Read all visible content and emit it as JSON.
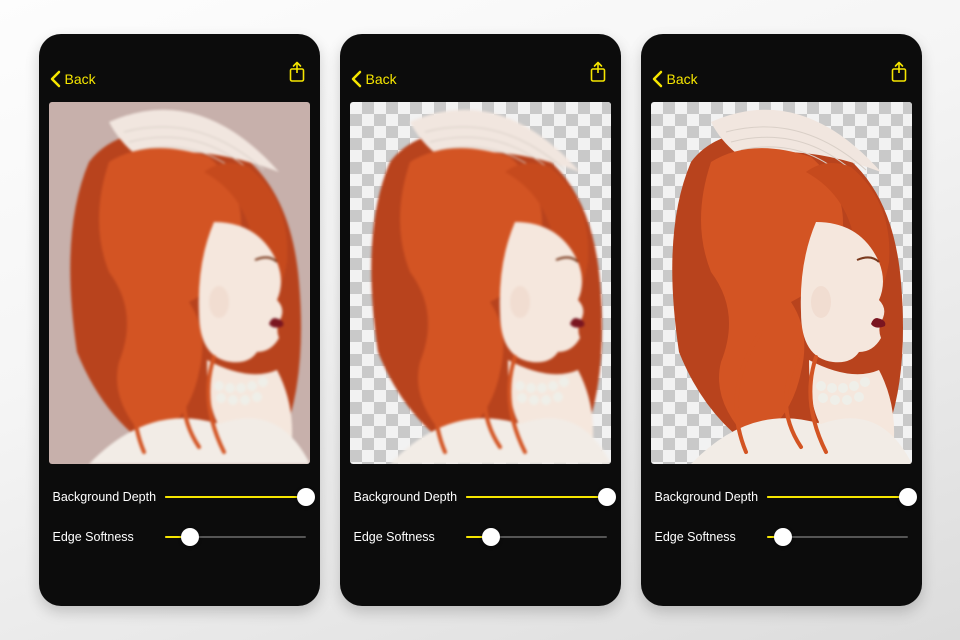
{
  "accentColor": "#f6e600",
  "screens": [
    {
      "back_label": "Back",
      "background": "solid",
      "sliders": {
        "bg_depth": {
          "label": "Background Depth",
          "value": 100
        },
        "edge_soft": {
          "label": "Edge Softness",
          "value": 18
        }
      }
    },
    {
      "back_label": "Back",
      "background": "transparent",
      "sliders": {
        "bg_depth": {
          "label": "Background Depth",
          "value": 100
        },
        "edge_soft": {
          "label": "Edge Softness",
          "value": 18
        }
      }
    },
    {
      "back_label": "Back",
      "background": "transparent",
      "sliders": {
        "bg_depth": {
          "label": "Background Depth",
          "value": 100
        },
        "edge_soft": {
          "label": "Edge Softness",
          "value": 12
        }
      }
    }
  ]
}
